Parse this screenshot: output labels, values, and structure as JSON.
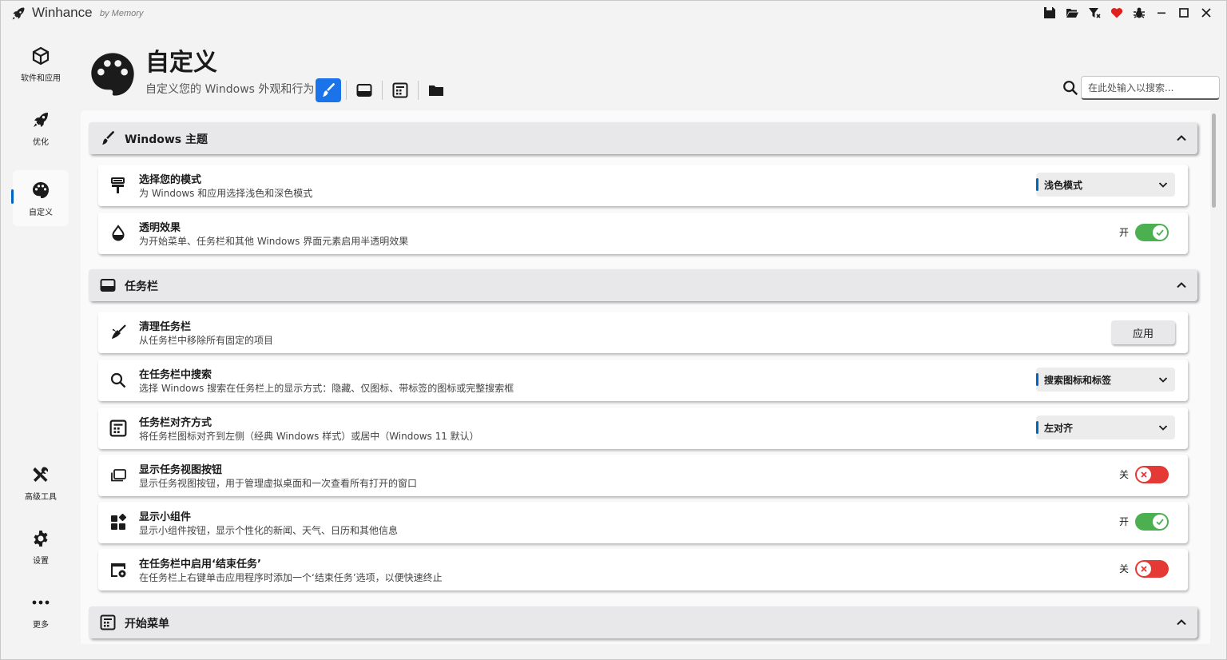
{
  "app": {
    "title": "Winhance",
    "subtitle": "by Memory"
  },
  "titlebar_icons": [
    "save-icon",
    "folder-open-icon",
    "filter-icon",
    "heart-icon",
    "bug-icon",
    "minimize-icon",
    "maximize-icon",
    "close-icon"
  ],
  "sidebar": {
    "items": [
      {
        "label": "软件和应用",
        "icon": "cube-icon",
        "active": false
      },
      {
        "label": "优化",
        "icon": "rocket-icon",
        "active": false
      },
      {
        "label": "自定义",
        "icon": "palette-icon",
        "active": true
      },
      {
        "label": "高级工具",
        "icon": "tools-icon",
        "active": false
      },
      {
        "label": "设置",
        "icon": "gear-icon",
        "active": false
      },
      {
        "label": "更多",
        "icon": "more-icon",
        "active": false
      }
    ]
  },
  "header": {
    "title": "自定义",
    "subtitle": "自定义您的 Windows 外观和行为",
    "quick_nav": [
      "brush-icon",
      "taskbar-icon",
      "start-menu-icon",
      "folder-icon"
    ]
  },
  "search": {
    "placeholder": "在此处输入以搜索..."
  },
  "sections": {
    "theme": {
      "title": "Windows 主题",
      "mode": {
        "title": "选择您的模式",
        "desc": "为 Windows 和应用选择浅色和深色模式",
        "value": "浅色模式"
      },
      "transparency": {
        "title": "透明效果",
        "desc": "为开始菜单、任务栏和其他 Windows 界面元素启用半透明效果",
        "state_label": "开",
        "state": "on"
      }
    },
    "taskbar": {
      "title": "任务栏",
      "clean": {
        "title": "清理任务栏",
        "desc": "从任务栏中移除所有固定的项目",
        "button": "应用"
      },
      "search": {
        "title": "在任务栏中搜索",
        "desc": "选择 Windows 搜索在任务栏上的显示方式：隐藏、仅图标、带标签的图标或完整搜索框",
        "value": "搜索图标和标签"
      },
      "align": {
        "title": "任务栏对齐方式",
        "desc": "将任务栏图标对齐到左侧（经典 Windows 样式）或居中（Windows 11 默认）",
        "value": "左对齐"
      },
      "taskview": {
        "title": "显示任务视图按钮",
        "desc": "显示任务视图按钮，用于管理虚拟桌面和一次查看所有打开的窗口",
        "state_label": "关",
        "state": "off"
      },
      "widgets": {
        "title": "显示小组件",
        "desc": "显示小组件按钮，显示个性化的新闻、天气、日历和其他信息",
        "state_label": "开",
        "state": "on"
      },
      "endtask": {
        "title": "在任务栏中启用‘结束任务’",
        "desc": "在任务栏上右键单击应用程序时添加一个‘结束任务’选项，以便快速终止",
        "state_label": "关",
        "state": "off"
      }
    },
    "start": {
      "title": "开始菜单"
    }
  },
  "colors": {
    "accent": "#0067c0",
    "toggle_on": "#4caf50",
    "toggle_off": "#e53935",
    "heart": "#e0201c"
  }
}
